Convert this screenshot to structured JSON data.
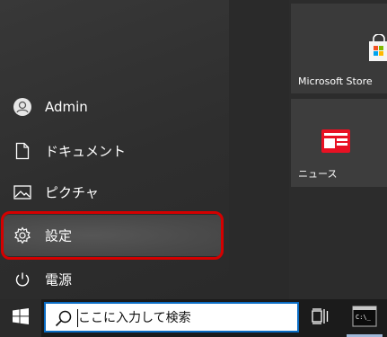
{
  "start_menu": {
    "items": [
      {
        "id": "admin",
        "label": "Admin",
        "icon": "user-avatar-icon"
      },
      {
        "id": "documents",
        "label": "ドキュメント",
        "icon": "document-icon"
      },
      {
        "id": "pictures",
        "label": "ピクチャ",
        "icon": "picture-icon"
      },
      {
        "id": "settings",
        "label": "設定",
        "icon": "gear-icon",
        "highlighted": true
      },
      {
        "id": "power",
        "label": "電源",
        "icon": "power-icon"
      }
    ],
    "highlight_color": "#d40000"
  },
  "tiles": [
    {
      "id": "microsoft-store",
      "label": "Microsoft Store",
      "icon": "store-bag-icon"
    },
    {
      "id": "news",
      "label": "ニュース",
      "icon": "news-icon",
      "accent": "#e81123"
    }
  ],
  "taskbar": {
    "start_icon": "windows-logo-icon",
    "search_placeholder": "ここに入力して検索",
    "search_value": "",
    "task_view_icon": "task-view-icon",
    "pinned_app_icon": "command-prompt-icon",
    "accent": "#0a6cc4"
  }
}
